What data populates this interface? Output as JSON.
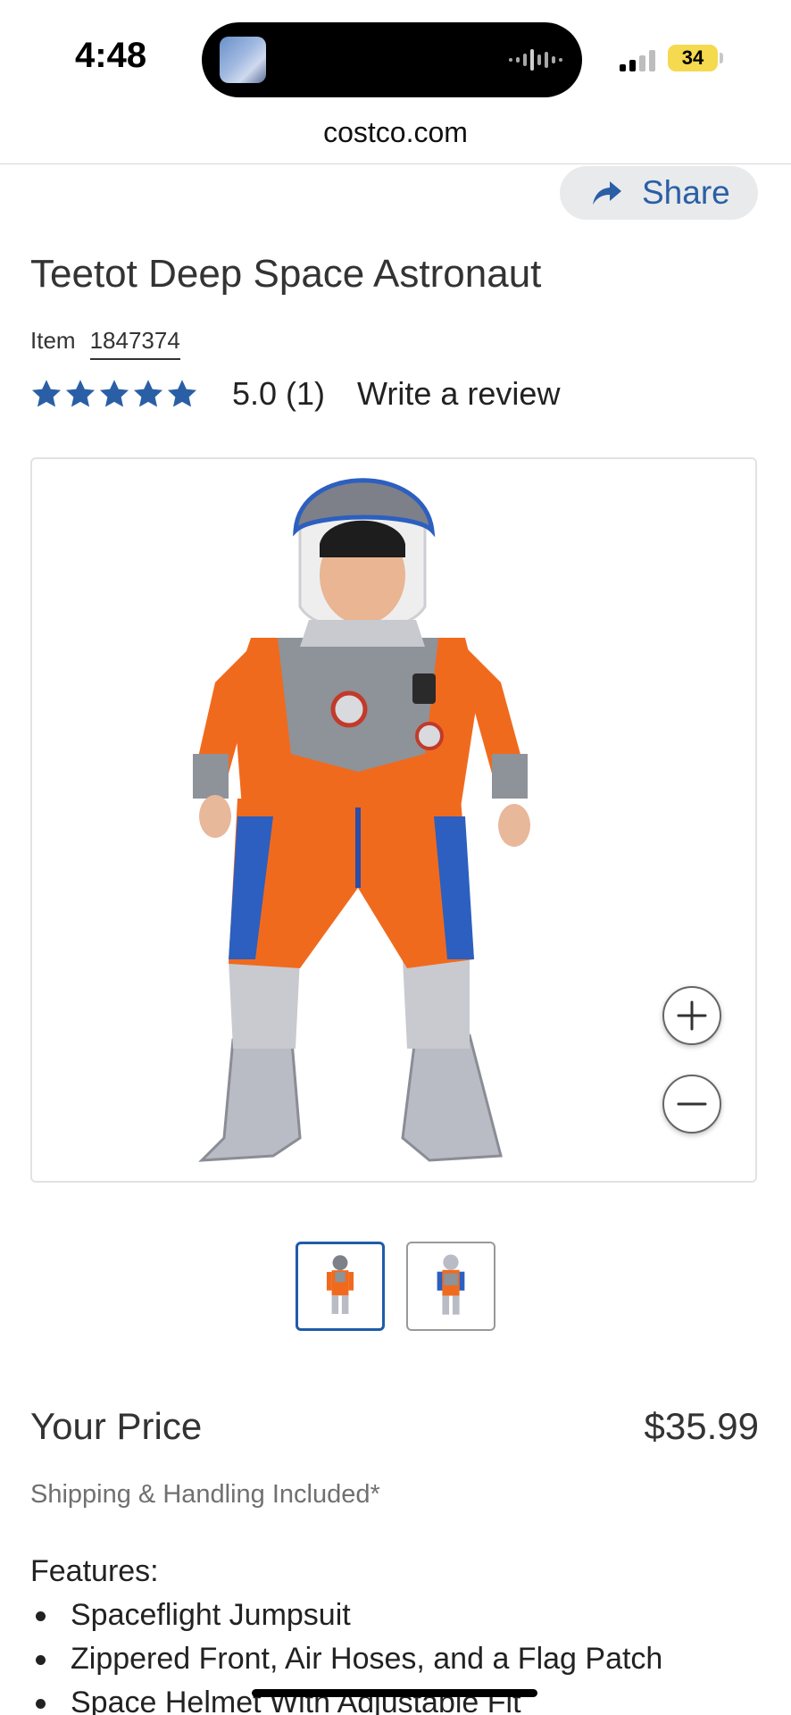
{
  "status_bar": {
    "time": "4:48",
    "battery": "34"
  },
  "browser": {
    "url": "costco.com"
  },
  "share": {
    "label": "Share"
  },
  "product": {
    "title": "Teetot Deep Space Astronaut",
    "item_label": "Item",
    "item_number": "1847374",
    "rating_value": "5.0 (1)",
    "review_link": "Write a review",
    "star_count": 5,
    "star_color": "#2a5fa6"
  },
  "image_viewer": {
    "zoom_in_icon": "plus-icon",
    "zoom_out_icon": "minus-icon",
    "thumbnails": [
      "front",
      "back"
    ],
    "selected_thumbnail": 0,
    "selected_border_color": "#1e5ca8"
  },
  "pricing": {
    "label": "Your Price",
    "value": "$35.99",
    "shipping": "Shipping & Handling Included*"
  },
  "features": {
    "title": "Features:",
    "items": [
      "Spaceflight Jumpsuit",
      "Zippered Front, Air Hoses, and a Flag Patch",
      "Space Helmet With Adjustable Fit"
    ]
  }
}
